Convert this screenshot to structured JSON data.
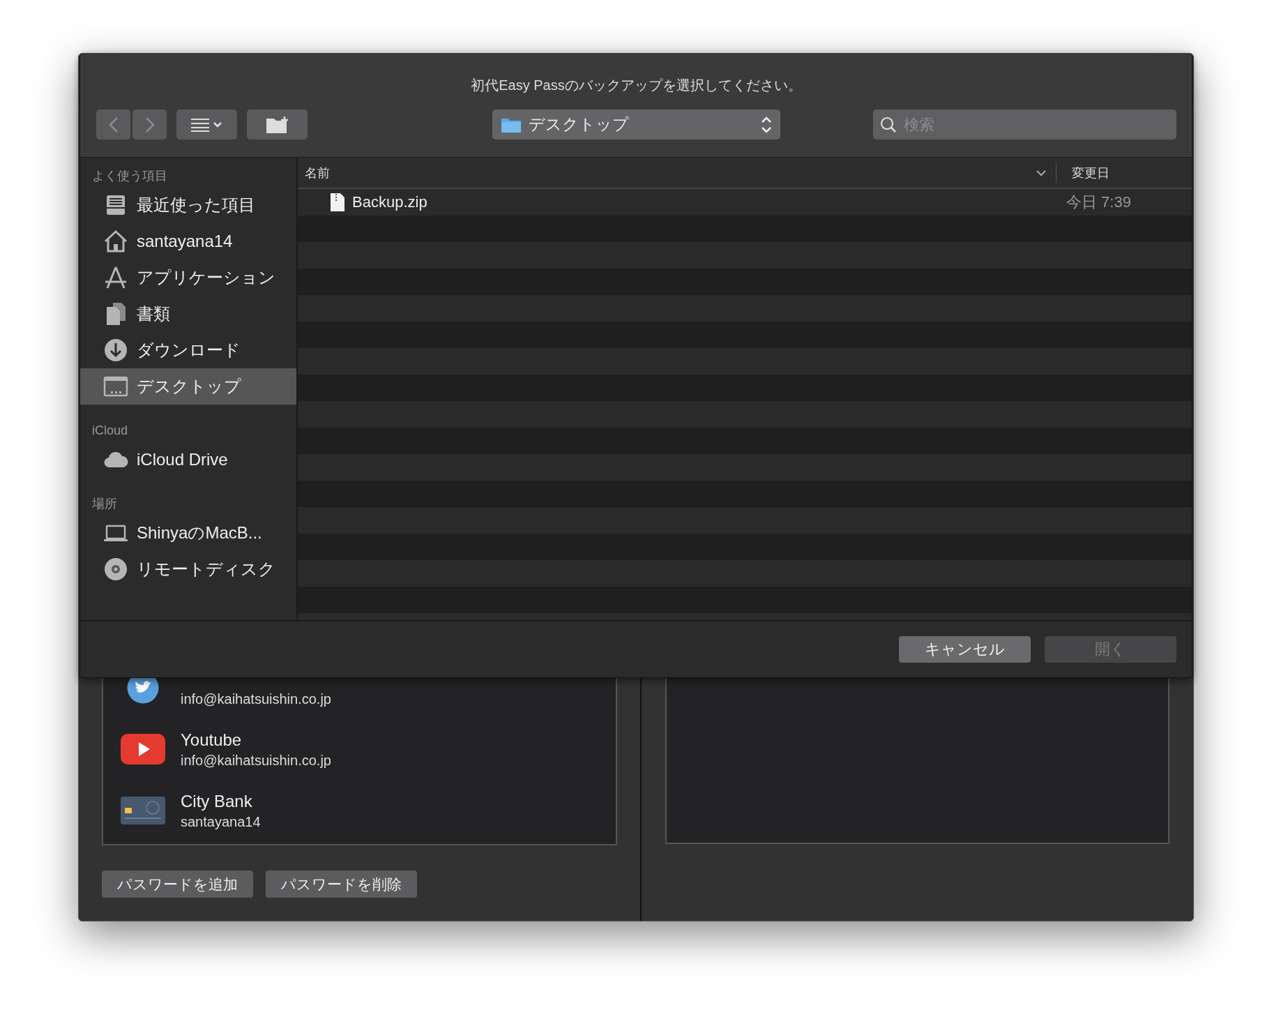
{
  "dialog": {
    "title": "初代Easy Passのバックアップを選択してください。",
    "location": "デスクトップ",
    "search": {
      "placeholder": "検索"
    },
    "sidebar": [
      {
        "heading": "よく使う項目",
        "items": [
          {
            "kind": "recents",
            "label": "最近使った項目",
            "selected": false
          },
          {
            "kind": "home",
            "label": "santayana14",
            "selected": false
          },
          {
            "kind": "apps",
            "label": "アプリケーション",
            "selected": false
          },
          {
            "kind": "documents",
            "label": "書類",
            "selected": false
          },
          {
            "kind": "downloads",
            "label": "ダウンロード",
            "selected": false
          },
          {
            "kind": "desktop",
            "label": "デスクトップ",
            "selected": true
          }
        ]
      },
      {
        "heading": "iCloud",
        "items": [
          {
            "kind": "cloud",
            "label": "iCloud Drive",
            "selected": false
          }
        ]
      },
      {
        "heading": "場所",
        "items": [
          {
            "kind": "laptop",
            "label": "ShinyaのMacB...",
            "selected": false
          },
          {
            "kind": "disc",
            "label": "リモートディスク",
            "selected": false
          }
        ]
      }
    ],
    "columns": [
      "名前",
      "変更日"
    ],
    "files": [
      {
        "name": "Backup.zip",
        "modified": "今日 7:39"
      }
    ],
    "buttons": [
      {
        "label": "キャンセル",
        "disabled": false
      },
      {
        "label": "開く",
        "disabled": true
      }
    ]
  },
  "accounts": [
    {
      "kind": "twitter",
      "subtitle": "info@kaihatsuishin.co.jp"
    },
    {
      "kind": "youtube",
      "title": "Youtube",
      "subtitle": "info@kaihatsuishin.co.jp"
    },
    {
      "kind": "bank",
      "title": "City Bank",
      "subtitle": "santayana14"
    }
  ],
  "actions": [
    "パスワードを追加",
    "パスワードを削除"
  ]
}
